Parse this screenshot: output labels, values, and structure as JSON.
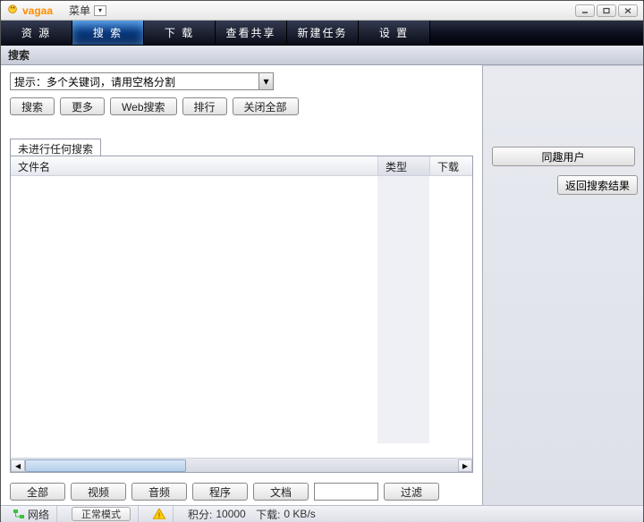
{
  "titlebar": {
    "app_name": "vagaa",
    "menu_label": "菜单"
  },
  "nav": {
    "resource": "资 源",
    "search": "搜 索",
    "download": "下 载",
    "view_share": "查看共享",
    "new_task": "新建任务",
    "settings": "设 置"
  },
  "panel": {
    "title": "搜索"
  },
  "search": {
    "dropdown_text": "提示：多个关键词，请用空格分割",
    "btn_search": "搜索",
    "btn_more": "更多",
    "btn_web": "Web搜索",
    "btn_rank": "排行",
    "btn_close_all": "关闭全部"
  },
  "results": {
    "tab_label": "未进行任何搜索",
    "col_name": "文件名",
    "col_type": "类型",
    "col_download": "下载"
  },
  "filters": {
    "all": "全部",
    "video": "视频",
    "audio": "音频",
    "program": "程序",
    "document": "文档",
    "filter": "过滤"
  },
  "right": {
    "same_interest_users": "同趣用户",
    "back_to_results": "返回搜索结果"
  },
  "status": {
    "network": "网络",
    "mode": "正常模式",
    "points_label": "积分:",
    "points_value": "10000",
    "download_label": "下载:",
    "download_value": "0 KB/s"
  }
}
